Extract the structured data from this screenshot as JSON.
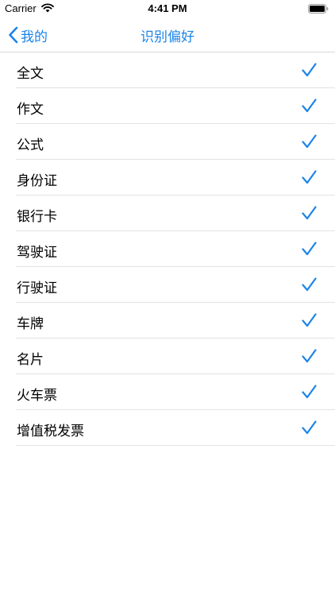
{
  "status": {
    "carrier": "Carrier",
    "time": "4:41 PM"
  },
  "nav": {
    "back_label": "我的",
    "title": "识别偏好"
  },
  "colors": {
    "accent": "#1b84e8"
  },
  "preferences": [
    {
      "label": "全文",
      "checked": true
    },
    {
      "label": "作文",
      "checked": true
    },
    {
      "label": "公式",
      "checked": true
    },
    {
      "label": "身份证",
      "checked": true
    },
    {
      "label": "银行卡",
      "checked": true
    },
    {
      "label": "驾驶证",
      "checked": true
    },
    {
      "label": "行驶证",
      "checked": true
    },
    {
      "label": "车牌",
      "checked": true
    },
    {
      "label": "名片",
      "checked": true
    },
    {
      "label": "火车票",
      "checked": true
    },
    {
      "label": "增值税发票",
      "checked": true
    }
  ]
}
